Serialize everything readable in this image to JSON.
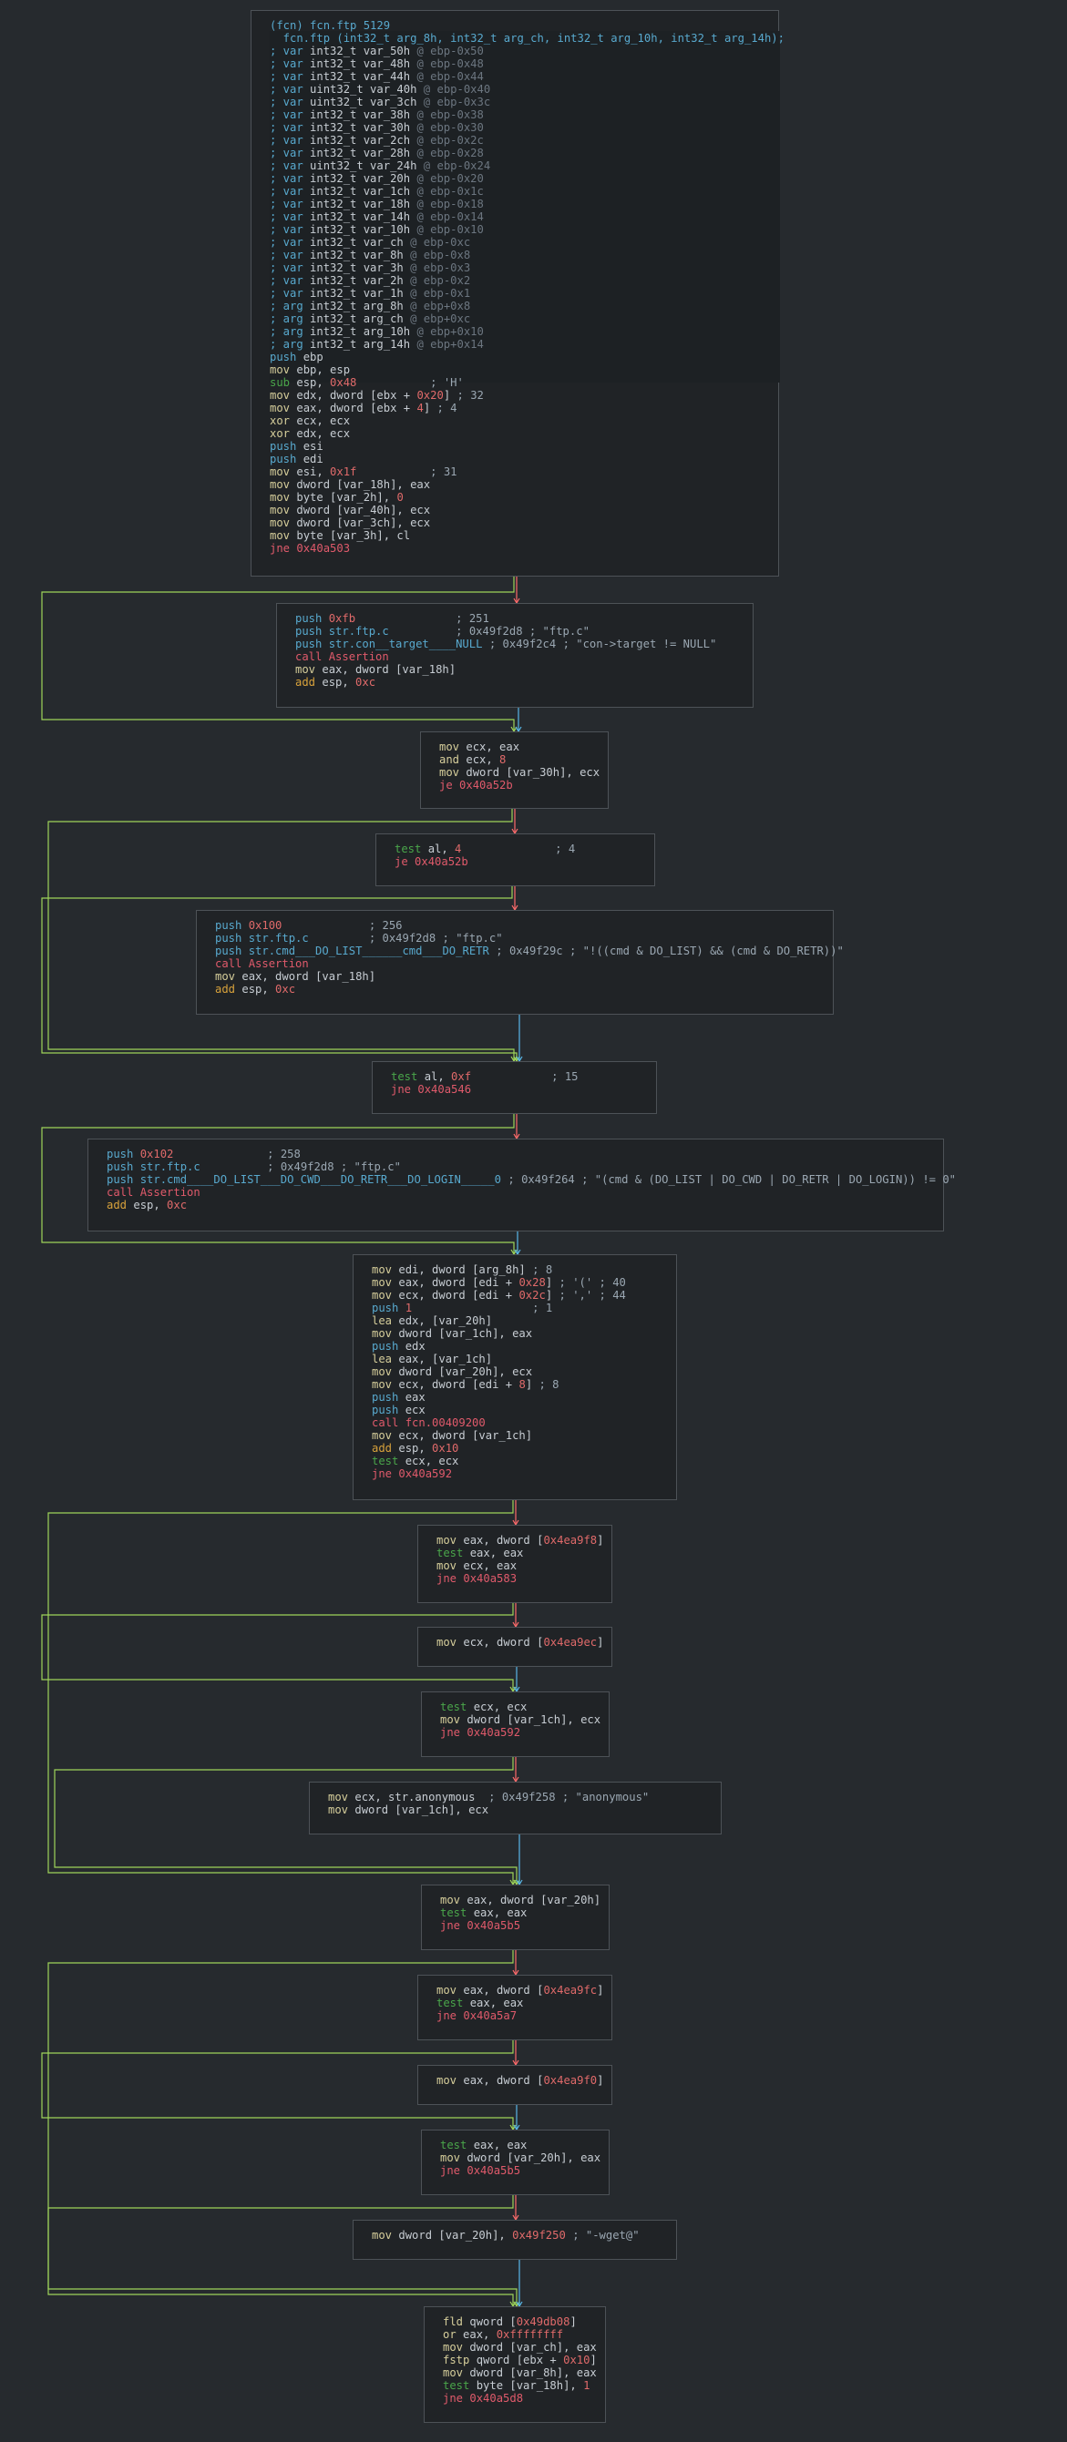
{
  "colors": {
    "background": "#262a2e",
    "node_bg": "#202326",
    "node_border": "#4d5257",
    "edge_true": "#9ed45a",
    "edge_false": "#ff6b6b",
    "edge_uncond": "#58b8e8"
  },
  "graph": {
    "header": {
      "title": "(fcn) fcn.ftp 5129",
      "signature": "  fcn.ftp (int32_t arg_8h, int32_t arg_ch, int32_t arg_10h, int32_t arg_14h);",
      "vars": [
        [
          "; var",
          " int32_t var_50h",
          " @ ebp-0x50"
        ],
        [
          "; var",
          " int32_t var_48h",
          " @ ebp-0x48"
        ],
        [
          "; var",
          " int32_t var_44h",
          " @ ebp-0x44"
        ],
        [
          "; var",
          " uint32_t var_40h",
          " @ ebp-0x40"
        ],
        [
          "; var",
          " uint32_t var_3ch",
          " @ ebp-0x3c"
        ],
        [
          "; var",
          " int32_t var_38h",
          " @ ebp-0x38"
        ],
        [
          "; var",
          " int32_t var_30h",
          " @ ebp-0x30"
        ],
        [
          "; var",
          " int32_t var_2ch",
          " @ ebp-0x2c"
        ],
        [
          "; var",
          " int32_t var_28h",
          " @ ebp-0x28"
        ],
        [
          "; var",
          " uint32_t var_24h",
          " @ ebp-0x24"
        ],
        [
          "; var",
          " int32_t var_20h",
          " @ ebp-0x20"
        ],
        [
          "; var",
          " int32_t var_1ch",
          " @ ebp-0x1c"
        ],
        [
          "; var",
          " int32_t var_18h",
          " @ ebp-0x18"
        ],
        [
          "; var",
          " int32_t var_14h",
          " @ ebp-0x14"
        ],
        [
          "; var",
          " int32_t var_10h",
          " @ ebp-0x10"
        ],
        [
          "; var",
          " int32_t var_ch",
          " @ ebp-0xc"
        ],
        [
          "; var",
          " int32_t var_8h",
          " @ ebp-0x8"
        ],
        [
          "; var",
          " int32_t var_3h",
          " @ ebp-0x3"
        ],
        [
          "; var",
          " int32_t var_2h",
          " @ ebp-0x2"
        ],
        [
          "; var",
          " int32_t var_1h",
          " @ ebp-0x1"
        ],
        [
          "; arg",
          " int32_t arg_8h",
          " @ ebp+0x8"
        ],
        [
          "; arg",
          " int32_t arg_ch",
          " @ ebp+0xc"
        ],
        [
          "; arg",
          " int32_t arg_10h",
          " @ ebp+0x10"
        ],
        [
          "; arg",
          " int32_t arg_14h",
          " @ ebp+0x14"
        ]
      ]
    },
    "blocks": [
      {
        "lines": [
          {
            "m": "push",
            "o": "ebp"
          },
          {
            "m": "mov",
            "o": "ebp, esp"
          },
          {
            "m": "sub",
            "o": "esp, ",
            "n": "0x48",
            "c": "; 'H'"
          },
          {
            "m": "mov",
            "o": "edx, dword [ebx + ",
            "n": "0x20",
            "o2": "]",
            "c": "; 32"
          },
          {
            "m": "mov",
            "o": "eax, dword [ebx + ",
            "n": "4",
            "o2": "]",
            "c": "; 4"
          },
          {
            "m": "xor",
            "o": "ecx, ecx"
          },
          {
            "m": "xor",
            "o": "edx, ecx"
          },
          {
            "m": "push",
            "o": "esi"
          },
          {
            "m": "push",
            "o": "edi"
          },
          {
            "m": "mov",
            "o": "esi, ",
            "n": "0x1f",
            "c": "; 31"
          },
          {
            "m": "mov",
            "o": "dword [var_18h], eax"
          },
          {
            "m": "mov",
            "o": "byte [var_2h], ",
            "n": "0"
          },
          {
            "m": "mov",
            "o": "dword [var_40h], ecx"
          },
          {
            "m": "mov",
            "o": "dword [var_3ch], ecx"
          },
          {
            "m": "mov",
            "o": "byte [var_3h], cl"
          },
          {
            "m": "jne",
            "o": "0x40a503"
          }
        ]
      },
      {
        "lines": [
          {
            "m": "push",
            "o": "",
            "n": "0xfb",
            "c": "; 251"
          },
          {
            "m": "push",
            "o": "str.ftp.c",
            "c": "; 0x49f2d8 ; \"ftp.c\""
          },
          {
            "m": "push",
            "o": "str.con__target____NULL",
            "c": "; 0x49f2c4 ; \"con->target != NULL\""
          },
          {
            "m": "call",
            "o": "Assertion"
          },
          {
            "m": "mov",
            "o": "eax, dword [var_18h]"
          },
          {
            "m": "add",
            "o": "esp, ",
            "n": "0xc"
          }
        ]
      },
      {
        "lines": [
          {
            "m": "mov",
            "o": "ecx, eax"
          },
          {
            "m": "and",
            "o": "ecx, ",
            "n": "8"
          },
          {
            "m": "mov",
            "o": "dword [var_30h], ecx"
          },
          {
            "m": "je",
            "o": "0x40a52b"
          }
        ]
      },
      {
        "lines": [
          {
            "m": "test",
            "o": "al, ",
            "n": "4",
            "c": "; 4"
          },
          {
            "m": "je",
            "o": "0x40a52b"
          }
        ]
      },
      {
        "lines": [
          {
            "m": "push",
            "o": "",
            "n": "0x100",
            "c": "; 256"
          },
          {
            "m": "push",
            "o": "str.ftp.c",
            "c": "; 0x49f2d8 ; \"ftp.c\""
          },
          {
            "m": "push",
            "o": "str.cmd___DO_LIST______cmd___DO_RETR",
            "c": "; 0x49f29c ; \"!((cmd & DO_LIST) && (cmd & DO_RETR))\""
          },
          {
            "m": "call",
            "o": "Assertion"
          },
          {
            "m": "mov",
            "o": "eax, dword [var_18h]"
          },
          {
            "m": "add",
            "o": "esp, ",
            "n": "0xc"
          }
        ]
      },
      {
        "lines": [
          {
            "m": "test",
            "o": "al, ",
            "n": "0xf",
            "c": "; 15"
          },
          {
            "m": "jne",
            "o": "0x40a546"
          }
        ]
      },
      {
        "lines": [
          {
            "m": "push",
            "o": "",
            "n": "0x102",
            "c": "; 258"
          },
          {
            "m": "push",
            "o": "str.ftp.c",
            "c": "; 0x49f2d8 ; \"ftp.c\""
          },
          {
            "m": "push",
            "o": "str.cmd____DO_LIST___DO_CWD___DO_RETR___DO_LOGIN_____0",
            "c": "; 0x49f264 ; \"(cmd & (DO_LIST | DO_CWD | DO_RETR | DO_LOGIN)) != 0\""
          },
          {
            "m": "call",
            "o": "Assertion"
          },
          {
            "m": "add",
            "o": "esp, ",
            "n": "0xc"
          }
        ]
      },
      {
        "lines": [
          {
            "m": "mov",
            "o": "edi, dword [arg_8h]",
            "c": "; 8"
          },
          {
            "m": "mov",
            "o": "eax, dword [edi + ",
            "n": "0x28",
            "o2": "]",
            "c": "; '(' ; 40"
          },
          {
            "m": "mov",
            "o": "ecx, dword [edi + ",
            "n": "0x2c",
            "o2": "]",
            "c": "; ',' ; 44"
          },
          {
            "m": "push",
            "o": "",
            "n": "1",
            "c": "; 1"
          },
          {
            "m": "lea",
            "o": "edx, [var_20h]"
          },
          {
            "m": "mov",
            "o": "dword [var_1ch], eax"
          },
          {
            "m": "push",
            "o": "edx"
          },
          {
            "m": "lea",
            "o": "eax, [var_1ch]"
          },
          {
            "m": "mov",
            "o": "dword [var_20h], ecx"
          },
          {
            "m": "mov",
            "o": "ecx, dword [edi + ",
            "n": "8",
            "o2": "]",
            "c": "; 8"
          },
          {
            "m": "push",
            "o": "eax"
          },
          {
            "m": "push",
            "o": "ecx"
          },
          {
            "m": "call",
            "o": "fcn.00409200"
          },
          {
            "m": "mov",
            "o": "ecx, dword [var_1ch]"
          },
          {
            "m": "add",
            "o": "esp, ",
            "n": "0x10"
          },
          {
            "m": "test",
            "o": "ecx, ecx"
          },
          {
            "m": "jne",
            "o": "0x40a592"
          }
        ]
      },
      {
        "lines": [
          {
            "m": "mov",
            "o": "eax, dword [",
            "n": "0x4ea9f8",
            "o2": "]"
          },
          {
            "m": "test",
            "o": "eax, eax"
          },
          {
            "m": "mov",
            "o": "ecx, eax"
          },
          {
            "m": "jne",
            "o": "0x40a583"
          }
        ]
      },
      {
        "lines": [
          {
            "m": "mov",
            "o": "ecx, dword [",
            "n": "0x4ea9ec",
            "o2": "]"
          }
        ]
      },
      {
        "lines": [
          {
            "m": "test",
            "o": "ecx, ecx"
          },
          {
            "m": "mov",
            "o": "dword [var_1ch], ecx"
          },
          {
            "m": "jne",
            "o": "0x40a592"
          }
        ]
      },
      {
        "lines": [
          {
            "m": "mov",
            "o": "ecx, str.anonymous",
            "c": "; 0x49f258 ; \"anonymous\""
          },
          {
            "m": "mov",
            "o": "dword [var_1ch], ecx"
          }
        ]
      },
      {
        "lines": [
          {
            "m": "mov",
            "o": "eax, dword [var_20h]"
          },
          {
            "m": "test",
            "o": "eax, eax"
          },
          {
            "m": "jne",
            "o": "0x40a5b5"
          }
        ]
      },
      {
        "lines": [
          {
            "m": "mov",
            "o": "eax, dword [",
            "n": "0x4ea9fc",
            "o2": "]"
          },
          {
            "m": "test",
            "o": "eax, eax"
          },
          {
            "m": "jne",
            "o": "0x40a5a7"
          }
        ]
      },
      {
        "lines": [
          {
            "m": "mov",
            "o": "eax, dword [",
            "n": "0x4ea9f0",
            "o2": "]"
          }
        ]
      },
      {
        "lines": [
          {
            "m": "test",
            "o": "eax, eax"
          },
          {
            "m": "mov",
            "o": "dword [var_20h], eax"
          },
          {
            "m": "jne",
            "o": "0x40a5b5"
          }
        ]
      },
      {
        "lines": [
          {
            "m": "mov",
            "o": "dword [var_20h], ",
            "n": "0x49f250",
            "c": "; \"-wget@\""
          }
        ]
      },
      {
        "lines": [
          {
            "m": "fld",
            "o": "qword [",
            "n": "0x49db08",
            "o2": "]"
          },
          {
            "m": "or",
            "o": "eax, ",
            "n": "0xffffffff"
          },
          {
            "m": "mov",
            "o": "dword [var_ch], eax"
          },
          {
            "m": "fstp",
            "o": "qword [ebx + ",
            "n": "0x10",
            "o2": "]"
          },
          {
            "m": "mov",
            "o": "dword [var_8h], eax"
          },
          {
            "m": "test",
            "o": "byte [var_18h], ",
            "n": "1"
          },
          {
            "m": "jne",
            "o": "0x40a5d8"
          }
        ]
      }
    ]
  }
}
